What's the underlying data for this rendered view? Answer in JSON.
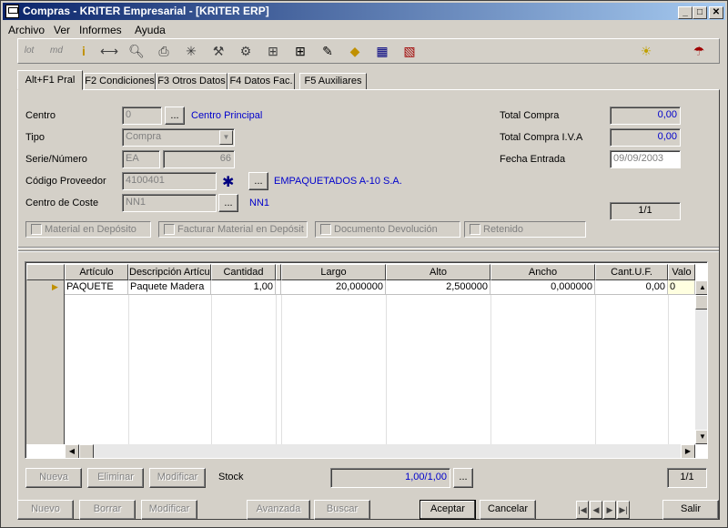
{
  "window": {
    "title": "Compras - KRITER Empresarial - [KRITER ERP]",
    "controls": [
      "_",
      "□",
      "✕"
    ]
  },
  "menu": [
    "Archivo",
    "Ver",
    "Informes",
    "Ayuda"
  ],
  "tabs": [
    "Alt+F1 Pral",
    "F2 Condiciones",
    "F3 Otros Datos",
    "F4 Datos Fac.",
    "F5 Auxiliares"
  ],
  "header": {
    "centro_label": "Centro",
    "centro_value": "0",
    "centro_name": "Centro Principal",
    "tipo_label": "Tipo",
    "tipo_value": "Compra",
    "serie_label": "Serie/Número",
    "serie_value": "EA",
    "numero_value": "66",
    "proveedor_label": "Código Proveedor",
    "proveedor_value": "4100401",
    "proveedor_name": "EMPAQUETADOS A-10 S.A.",
    "coste_label": "Centro de Coste",
    "coste_value": "NN1",
    "coste_name": "NN1",
    "total_compra_label": "Total Compra",
    "total_compra_value": "0,00",
    "total_iva_label": "Total Compra I.V.A",
    "total_iva_value": "0,00",
    "fecha_label": "Fecha Entrada",
    "fecha_value": "09/09/2003",
    "page_counter": "1/1",
    "ellipsis": "..."
  },
  "checkboxes": [
    "Material en Depósito",
    "Facturar Material en Depósit",
    "Documento Devolución",
    "Retenido"
  ],
  "grid": {
    "columns": [
      "Artículo",
      "Descripción Artículo",
      "Cantidad",
      "",
      "Largo",
      "Alto",
      "Ancho",
      "Cant.U.F.",
      "Valo"
    ],
    "rows": [
      [
        "PAQUETE",
        "Paquete Madera",
        "1,00",
        "",
        "20,000000",
        "2,500000",
        "0,000000",
        "0,00",
        "0"
      ]
    ]
  },
  "grid_buttons": {
    "nueva": "Nueva",
    "eliminar": "Eliminar",
    "modificar": "Modificar",
    "stock_label": "Stock",
    "stock_value": "1,00/1,00",
    "ellipsis": "...",
    "counter": "1/1"
  },
  "bottom_buttons": {
    "nuevo": "Nuevo",
    "borrar": "Borrar",
    "modificar": "Modificar",
    "avanzada": "Avanzada",
    "buscar": "Buscar",
    "aceptar": "Aceptar",
    "cancelar": "Cancelar",
    "salir": "Salir"
  },
  "toolbar_icons": [
    "lot-icon",
    "md-icon",
    "info-icon",
    "split-icon",
    "preview-icon",
    "print-icon",
    "asterisk-icon",
    "tools-icon",
    "wrench-icon",
    "tree-icon",
    "grid-icon",
    "stamp-icon",
    "warning-icon",
    "calculator-icon",
    "report-icon",
    "bulb-icon",
    "help-icon"
  ],
  "toolbar_text": {
    "lot": "lot",
    "md": "md",
    "info": "i"
  },
  "colors": {
    "accent": "#0a246a",
    "link": "#0000cc",
    "face": "#d4d0c8"
  }
}
